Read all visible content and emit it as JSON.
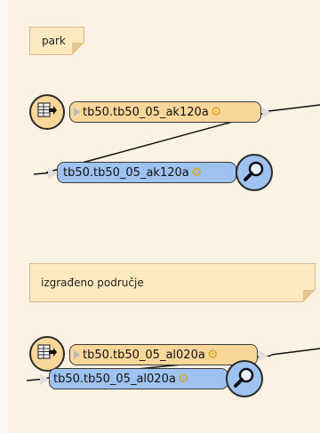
{
  "annotations": [
    {
      "text": "park"
    },
    {
      "text": "izgrađeno područje"
    }
  ],
  "readers": [
    {
      "label": "tb50.tb50_05_ak120a",
      "icon": "table-reader-icon",
      "gear": "gear-icon"
    },
    {
      "label": "tb50.tb50_05_al020a",
      "icon": "table-reader-icon",
      "gear": "gear-icon"
    }
  ],
  "writers": [
    {
      "label": "tb50.tb50_05_ak120a",
      "icon": "magnifier-icon",
      "gear": "gear-icon"
    },
    {
      "label": "tb50.tb50_05_al020a",
      "icon": "magnifier-icon",
      "gear": "gear-icon"
    }
  ],
  "colors": {
    "canvas": "#fbf2e3",
    "annotation": "#fce9bf",
    "reader": "#f9d79a",
    "writer": "#9ec3f0"
  }
}
